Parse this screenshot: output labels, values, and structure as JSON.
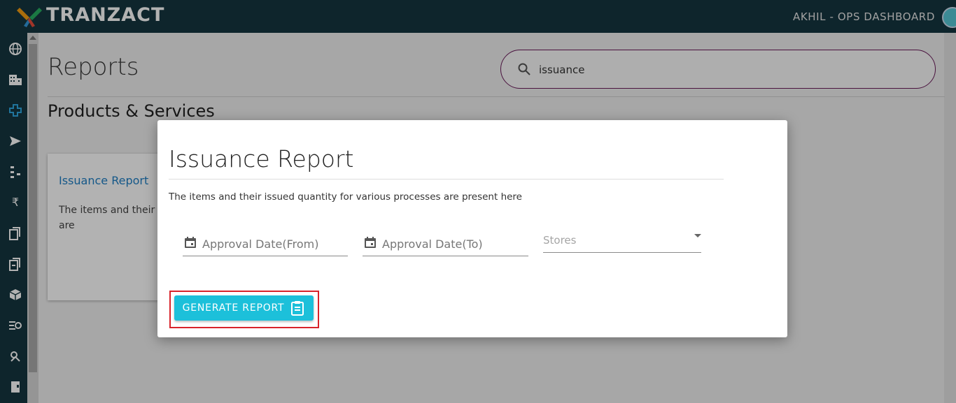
{
  "header": {
    "brand": "TRANZACT",
    "user_label": "AKHIL - OPS DASHBOARD"
  },
  "sidebar": {
    "icons": [
      "globe-icon",
      "building-icon",
      "plus-icon",
      "send-icon",
      "hierarchy-icon",
      "rupee-icon",
      "documents-icon",
      "report-icon",
      "package-icon",
      "flow-icon",
      "puzzle-icon",
      "book-icon"
    ]
  },
  "page": {
    "title": "Reports",
    "search_value": "issuance",
    "section_title": "Products & Services"
  },
  "card": {
    "title": "Issuance Report",
    "description": "The items and their is various processes are"
  },
  "modal": {
    "title": "Issuance Report",
    "description": "The items and their issued quantity for various processes are present here",
    "from_label": "Approval Date(From)",
    "to_label": "Approval Date(To)",
    "stores_label": "Stores",
    "generate_label": "GENERATE REPORT"
  },
  "colors": {
    "header_bg": "#15363f",
    "accent_button": "#1cc0da",
    "highlight_border": "#d8232a",
    "search_border": "#6a1b5a",
    "link": "#1f7fc4"
  }
}
